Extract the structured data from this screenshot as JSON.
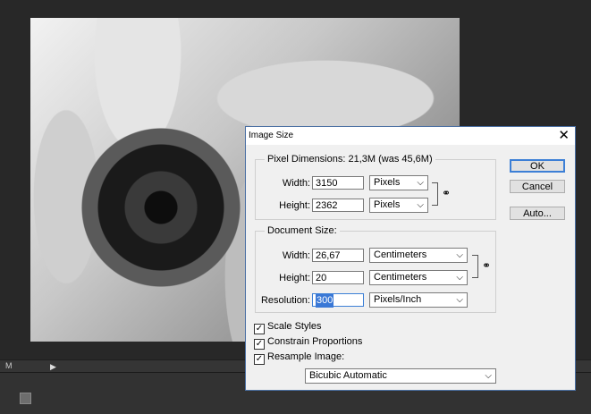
{
  "timeline": {
    "zoom": "M"
  },
  "dialog": {
    "title": "Image Size",
    "pixel_dimensions": {
      "legend": "Pixel Dimensions:  21,3M (was 45,6M)",
      "width_label": "Width:",
      "width_value": "3150",
      "width_unit": "Pixels",
      "height_label": "Height:",
      "height_value": "2362",
      "height_unit": "Pixels"
    },
    "document_size": {
      "legend": "Document Size:",
      "width_label": "Width:",
      "width_value": "26,67",
      "width_unit": "Centimeters",
      "height_label": "Height:",
      "height_value": "20",
      "height_unit": "Centimeters",
      "resolution_label": "Resolution:",
      "resolution_value": "300",
      "resolution_unit": "Pixels/Inch"
    },
    "buttons": {
      "ok": "OK",
      "cancel": "Cancel",
      "auto": "Auto..."
    },
    "options": {
      "scale_styles": "Scale Styles",
      "constrain_proportions": "Constrain Proportions",
      "resample_image": "Resample Image:",
      "resample_method": "Bicubic Automatic"
    }
  }
}
